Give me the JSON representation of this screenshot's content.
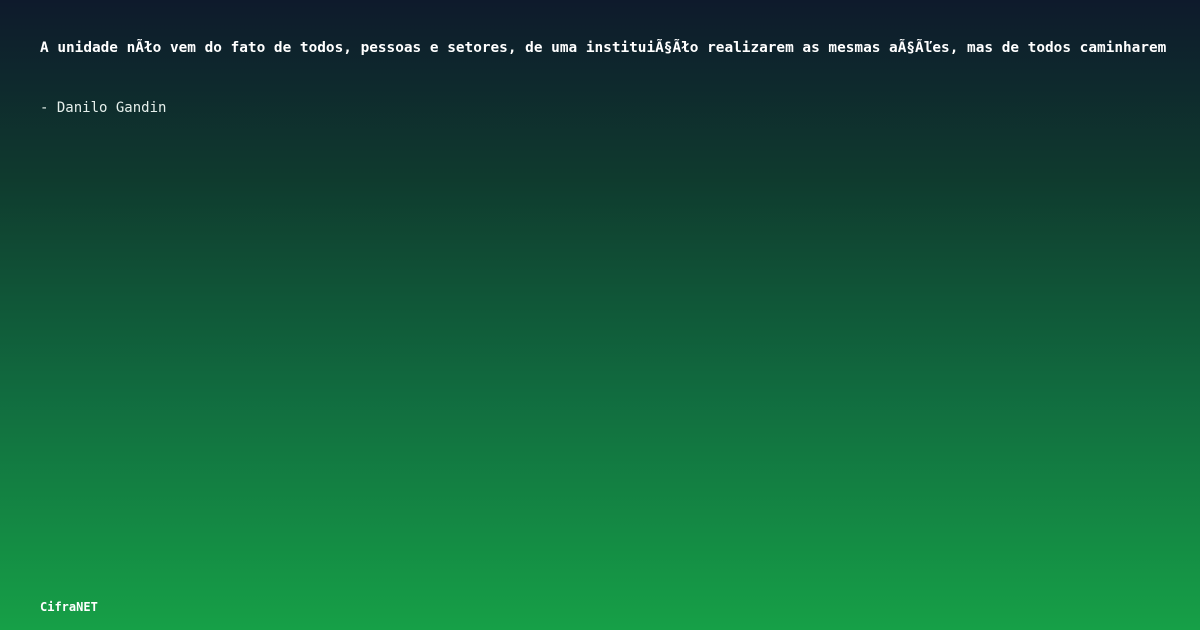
{
  "quote": {
    "text": "A unidade nÃło vem do fato de todos, pessoas e setores, de uma instituiÃ§Ãło realizarem as mesmas aÃ§Ãľes, mas de todos caminharem",
    "author": "- Danilo Gandin"
  },
  "brand": {
    "name": "CifraNET"
  },
  "colors": {
    "background_top": "#0e1a2c",
    "background_bottom": "#16a047",
    "text": "#ffffff"
  }
}
